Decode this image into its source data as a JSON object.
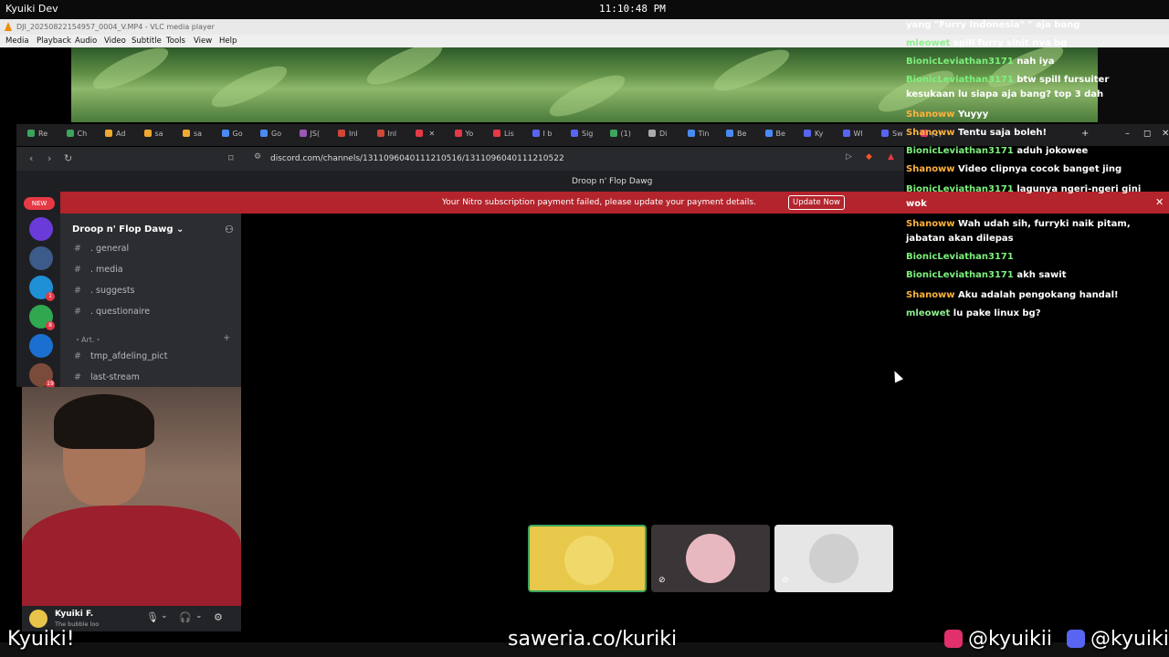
{
  "topbar": {
    "workspace": "Kyuiki Dev",
    "clock": "11:10:48 PM"
  },
  "vlc": {
    "title": "DJI_20250822154957_0004_V.MP4 - VLC media player",
    "menu": [
      "Media",
      "Playback",
      "Audio",
      "Video",
      "Subtitle",
      "Tools",
      "View",
      "Help"
    ]
  },
  "browser": {
    "tabs": [
      {
        "label": "Re",
        "color": "#3ba55c"
      },
      {
        "label": "Ch",
        "color": "#3ba55c"
      },
      {
        "label": "Ad",
        "color": "#f0a830"
      },
      {
        "label": "sa",
        "color": "#f0a830"
      },
      {
        "label": "sa",
        "color": "#f0a830"
      },
      {
        "label": "Go",
        "color": "#4a8af4"
      },
      {
        "label": "Go",
        "color": "#4a8af4"
      },
      {
        "label": "JS(",
        "color": "#9b59b6"
      },
      {
        "label": "Inl",
        "color": "#d44638"
      },
      {
        "label": "Inl",
        "color": "#d44638"
      },
      {
        "label": "",
        "color": "#e63946"
      },
      {
        "label": "Yo",
        "color": "#e63946"
      },
      {
        "label": "Lis",
        "color": "#e63946"
      },
      {
        "label": "I b",
        "color": "#5865f2"
      },
      {
        "label": "Sig",
        "color": "#5865f2"
      },
      {
        "label": "(1)",
        "color": "#3ba55c"
      },
      {
        "label": "Di",
        "color": "#aaaaaa"
      },
      {
        "label": "Tin",
        "color": "#4a8af4"
      },
      {
        "label": "Be",
        "color": "#4a8af4"
      },
      {
        "label": "Be",
        "color": "#4a8af4"
      },
      {
        "label": "Ky",
        "color": "#5865f2"
      },
      {
        "label": "Wl",
        "color": "#5865f2"
      },
      {
        "label": "Sw",
        "color": "#5865f2"
      },
      {
        "label": "(1)",
        "color": "#e1306c"
      }
    ],
    "url": "discord.com/channels/1311096040111210516/1311096040111210522",
    "page_title": "Droop n' Flop Dawg"
  },
  "banner": {
    "message": "Your Nitro subscription payment failed, please update your payment details.",
    "button": "Update Now"
  },
  "servers": {
    "new_label": "NEW",
    "items": [
      {
        "color": "#6a3bd9",
        "badge": ""
      },
      {
        "color": "#3c5a8a",
        "badge": ""
      },
      {
        "color": "#1f8fd6",
        "badge": "1"
      },
      {
        "color": "#2fa84f",
        "badge": "8"
      },
      {
        "color": "#1a6fd0",
        "badge": ""
      },
      {
        "color": "#7a4a3a",
        "badge": "19"
      }
    ]
  },
  "guild": {
    "name": "Droop n' Flop Dawg",
    "channels": [
      {
        "name": ". general"
      },
      {
        "name": ". media"
      },
      {
        "name": ". suggests"
      },
      {
        "name": ". questionaire"
      }
    ],
    "category": "・Art.・",
    "channels2": [
      {
        "name": "tmp_afdeling_pict"
      },
      {
        "name": "last-stream"
      }
    ]
  },
  "user": {
    "name": "Kyuiki F.",
    "status": "The bubble loo"
  },
  "chat": [
    {
      "user": "",
      "text": "yang \"Furry Indonesia\" \" aja bang",
      "color": "#7cf07c"
    },
    {
      "user": "mleowet",
      "text": "spill furry sinit nya bg",
      "color": "#8ef08e"
    },
    {
      "user": "BionicLeviathan3171",
      "text": "nah iya",
      "color": "#7cf07c"
    },
    {
      "user": "BionicLeviathan3171",
      "text": "btw spill fursuiter kesukaan lu siapa aja bang? top 3 dah",
      "color": "#7cf07c"
    },
    {
      "user": "Shanoww",
      "text": "Yuyyy",
      "color": "#ffb23c"
    },
    {
      "user": "Shanoww",
      "text": "Tentu saja boleh!",
      "color": "#ffb23c"
    },
    {
      "user": "BionicLeviathan3171",
      "text": "aduh jokowee",
      "color": "#7cf07c"
    },
    {
      "user": "Shanoww",
      "text": "Video clipnya cocok banget jing",
      "color": "#ffb23c"
    },
    {
      "user": "BionicLeviathan3171",
      "text": "lagunya ngeri-ngeri gini wok",
      "color": "#7cf07c"
    },
    {
      "user": "Shanoww",
      "text": "Wah udah sih, furryki naik pitam, jabatan akan dilepas",
      "color": "#ffb23c"
    },
    {
      "user": "BionicLeviathan3171",
      "text": "",
      "color": "#7cf07c"
    },
    {
      "user": "BionicLeviathan3171",
      "text": "akh sawit",
      "color": "#7cf07c"
    },
    {
      "user": "Shanoww",
      "text": "Aku adalah pengokang handal!",
      "color": "#ffb23c"
    },
    {
      "user": "mleowet",
      "text": "lu pake linux bg?",
      "color": "#8ef08e"
    }
  ],
  "overlay": {
    "left": "Kyuiki!",
    "center": "saweria.co/kuriki",
    "instagram": "@kyuikii",
    "discord": "@kyuiki"
  },
  "tiles": [
    {
      "bg": "#e8c84a",
      "avatar": "#f0d86a",
      "selected": true
    },
    {
      "bg": "#3a3536",
      "avatar": "#e8b8c0",
      "selected": false
    },
    {
      "bg": "#e6e6e6",
      "avatar": "#cfcfcf",
      "selected": false
    }
  ]
}
